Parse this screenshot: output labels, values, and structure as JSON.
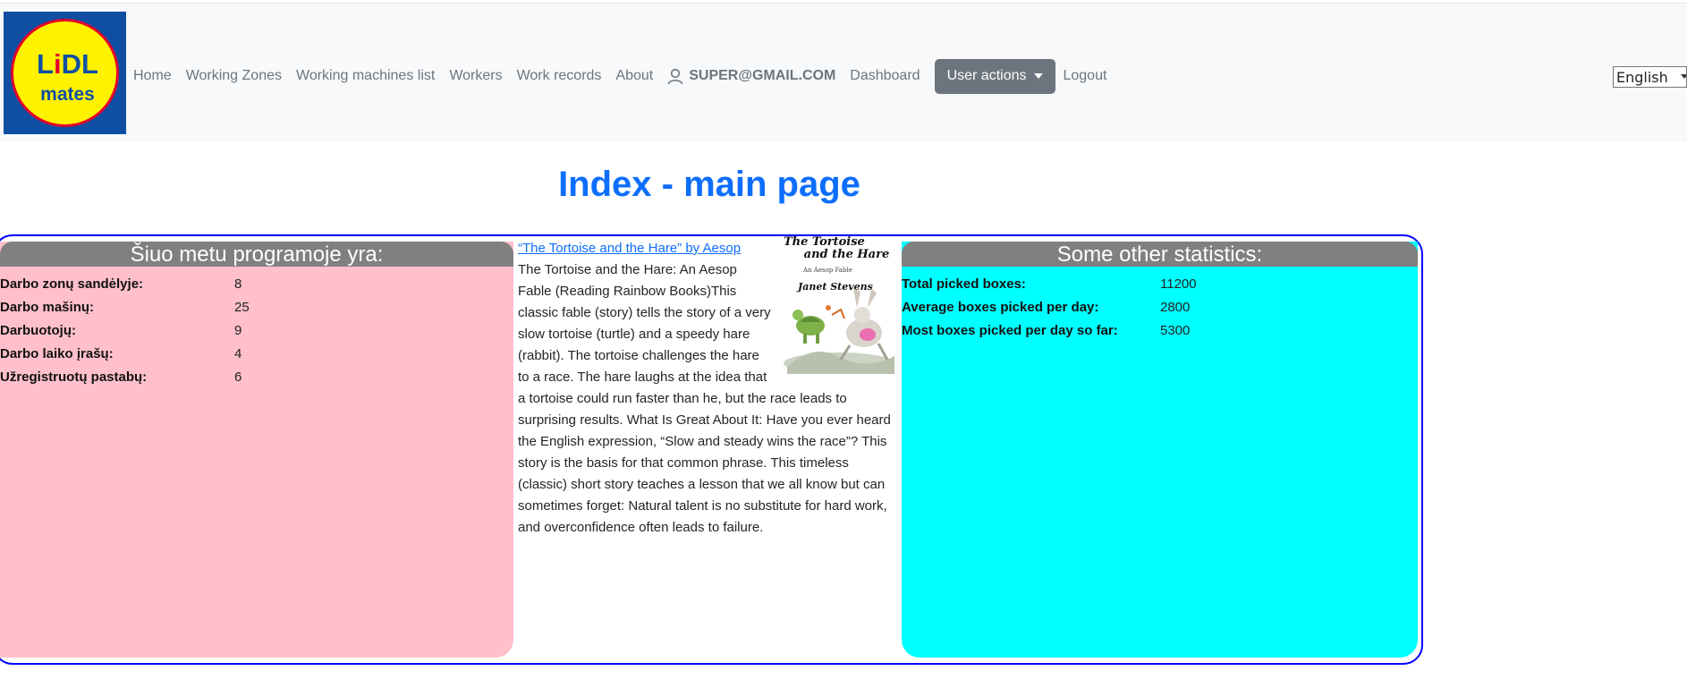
{
  "navbar": {
    "logo_text_1": "L",
    "logo_text_dot": "i",
    "logo_text_2": "DL",
    "logo_text_mates": "mates",
    "links": {
      "home": "Home",
      "working_zones": "Working Zones",
      "machines": "Working machines list",
      "workers": "Workers",
      "work_records": "Work records",
      "about": "About",
      "user_email": "SUPER@GMAIL.COM",
      "dashboard": "Dashboard",
      "user_actions": "User actions",
      "logout": "Logout"
    },
    "language": "English"
  },
  "page_title": "Index - main page",
  "left_panel": {
    "heading": "Šiuo metu programoje yra:",
    "rows": [
      {
        "label": "Darbo zonų sandėlyje:",
        "value": "8"
      },
      {
        "label": "Darbo mašinų:",
        "value": "25"
      },
      {
        "label": "Darbuotojų:",
        "value": "9"
      },
      {
        "label": "Darbo laiko įrašų:",
        "value": "4"
      },
      {
        "label": "Užregistruotų pastabų:",
        "value": "6"
      }
    ]
  },
  "middle": {
    "link": "“The Tortoise and the Hare” by Aesop",
    "book_title_1": "The Tortoise",
    "book_title_2": "and the Hare",
    "book_subtitle": "An Aesop Fable",
    "book_author": "Janet Stevens",
    "text": "The Tortoise and the Hare: An Aesop Fable (Reading Rainbow Books)This classic fable (story) tells the story of a very slow tortoise (turtle) and a speedy hare (rabbit). The tortoise challenges the hare to a race. The hare laughs at the idea that a tortoise could run faster than he, but the race leads to surprising results. What Is Great About It: Have you ever heard the English expression, “Slow and steady wins the race”? This story is the basis for that common phrase. This timeless (classic) short story teaches a lesson that we all know but can sometimes forget: Natural talent is no substitute for hard work, and overconfidence often leads to failure."
  },
  "right_panel": {
    "heading": "Some other statistics:",
    "rows": [
      {
        "label": "Total picked boxes:",
        "value": "11200"
      },
      {
        "label": "Average boxes picked per day:",
        "value": "2800"
      },
      {
        "label": "Most boxes picked per day so far:",
        "value": "5300"
      }
    ]
  },
  "colors": {
    "accent": "#0d6efd",
    "left_panel": "#ffc0cb",
    "right_panel": "#00ffff",
    "panel_header": "#808080",
    "border": "#0000ff"
  },
  "icons": {
    "user": "person-icon",
    "dropdown": "caret-down-icon"
  }
}
